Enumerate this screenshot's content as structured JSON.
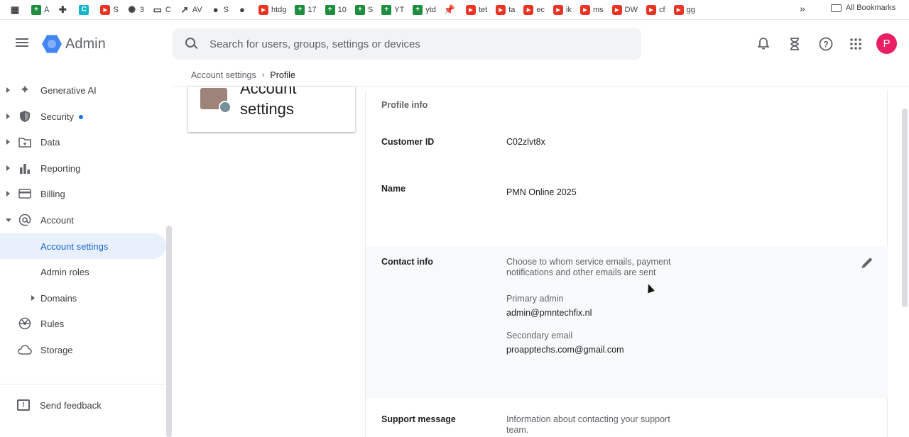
{
  "bookmarks": {
    "items": [
      {
        "label": "",
        "icon": "apps-grid-icon"
      },
      {
        "label": "A",
        "icon": "sheets-icon"
      },
      {
        "label": "",
        "icon": "puzzle-icon"
      },
      {
        "label": "",
        "icon": "canva-icon"
      },
      {
        "label": "S",
        "icon": "youtube-icon"
      },
      {
        "label": "3",
        "icon": "openai-icon"
      },
      {
        "label": "C",
        "icon": "folder-icon"
      },
      {
        "label": "AV",
        "icon": "trend-icon"
      },
      {
        "label": "S",
        "icon": "globe-icon"
      },
      {
        "label": "",
        "icon": "github-icon"
      },
      {
        "label": "htdg",
        "icon": "youtube-icon"
      },
      {
        "label": "17",
        "icon": "sheets-icon"
      },
      {
        "label": "10",
        "icon": "sheets-icon"
      },
      {
        "label": "S",
        "icon": "sheets-icon"
      },
      {
        "label": "YT",
        "icon": "sheets-icon"
      },
      {
        "label": "ytd",
        "icon": "sheets-icon"
      },
      {
        "label": "",
        "icon": "pin-icon"
      },
      {
        "label": "tet",
        "icon": "youtube-icon"
      },
      {
        "label": "ta",
        "icon": "youtube-icon"
      },
      {
        "label": "ec",
        "icon": "youtube-icon"
      },
      {
        "label": "ik",
        "icon": "youtube-icon"
      },
      {
        "label": "ms",
        "icon": "youtube-icon"
      },
      {
        "label": "DW",
        "icon": "youtube-icon"
      },
      {
        "label": "cf",
        "icon": "youtube-icon"
      },
      {
        "label": "gg",
        "icon": "youtube-icon"
      }
    ],
    "more": "»",
    "all_bookmarks": "All Bookmarks"
  },
  "header": {
    "app_name": "Admin",
    "search_placeholder": "Search for users, groups, settings or devices",
    "avatar_letter": "P"
  },
  "breadcrumb": {
    "parent": "Account settings",
    "separator": "›",
    "current": "Profile"
  },
  "sidebar": {
    "items": [
      {
        "label": "Generative AI",
        "icon": "sparkle-icon",
        "caret": "right"
      },
      {
        "label": "Security",
        "icon": "shield-icon",
        "caret": "right",
        "dot": true
      },
      {
        "label": "Data",
        "icon": "folder-star-icon",
        "caret": "right"
      },
      {
        "label": "Reporting",
        "icon": "bar-chart-icon",
        "caret": "right"
      },
      {
        "label": "Billing",
        "icon": "credit-card-icon",
        "caret": "right"
      },
      {
        "label": "Account",
        "icon": "at-sign-icon",
        "caret": "down"
      },
      {
        "label": "Account settings",
        "active": true
      },
      {
        "label": "Admin roles"
      },
      {
        "label": "Domains",
        "caret": "right"
      },
      {
        "label": "Rules",
        "icon": "rules-icon"
      },
      {
        "label": "Storage",
        "icon": "cloud-icon"
      }
    ],
    "feedback": "Send feedback"
  },
  "card": {
    "title": "Account settings"
  },
  "profile": {
    "section_title": "Profile info",
    "customer_id_label": "Customer ID",
    "customer_id_value": "C02zlvt8x",
    "name_label": "Name",
    "name_value": "PMN Online 2025",
    "contact_label": "Contact info",
    "contact_desc": "Choose to whom service emails, payment notifications and other emails are sent",
    "primary_admin_label": "Primary admin",
    "primary_admin_value": "admin@pmntechfix.nl",
    "secondary_email_label": "Secondary email",
    "secondary_email_value": "proapptechs.com@gmail.com",
    "support_label": "Support message",
    "support_desc": "Information about contacting your support team."
  },
  "colors": {
    "accent": "#1a73e8",
    "active_bg": "#e8f0fe",
    "avatar": "#e91e63"
  }
}
